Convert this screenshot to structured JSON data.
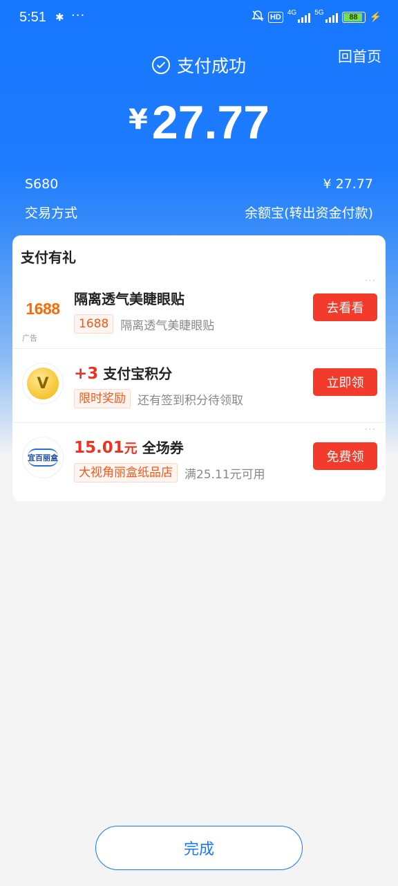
{
  "status_bar": {
    "time": "5:51",
    "hd_label": "HD",
    "net1": "4G",
    "net2": "5G",
    "battery": "88"
  },
  "header": {
    "home_link": "回首页",
    "success_text": "支付成功",
    "currency": "¥",
    "amount": "27.77"
  },
  "details": {
    "merchant": "S680",
    "merchant_amount": "¥ 27.77",
    "method_label": "交易方式",
    "method_value": "余额宝(转出资金付款)"
  },
  "rewards": {
    "title": "支付有礼",
    "items": [
      {
        "logo_text": "1688",
        "ad_label": "广告",
        "title": "隔离透气美睫眼贴",
        "tag": "1688",
        "desc": "隔离透气美睫眼贴",
        "button": "去看看"
      },
      {
        "logo_text": "V",
        "title_highlight": "+3",
        "title": "支付宝积分",
        "tag": "限时奖励",
        "desc": "还有签到积分待领取",
        "button": "立即领"
      },
      {
        "logo_text": "宜百丽盒",
        "title_highlight": "15.01",
        "title_unit": "元",
        "title": "全场券",
        "tag": "大视角丽盒纸品店",
        "desc": "满25.11元可用",
        "button": "免费领"
      }
    ]
  },
  "footer": {
    "done_label": "完成"
  },
  "colors": {
    "primary": "#1677ff",
    "button_red": "#f33b2b",
    "highlight_red": "#ea3323",
    "tag_orange": "#f05a1a"
  }
}
